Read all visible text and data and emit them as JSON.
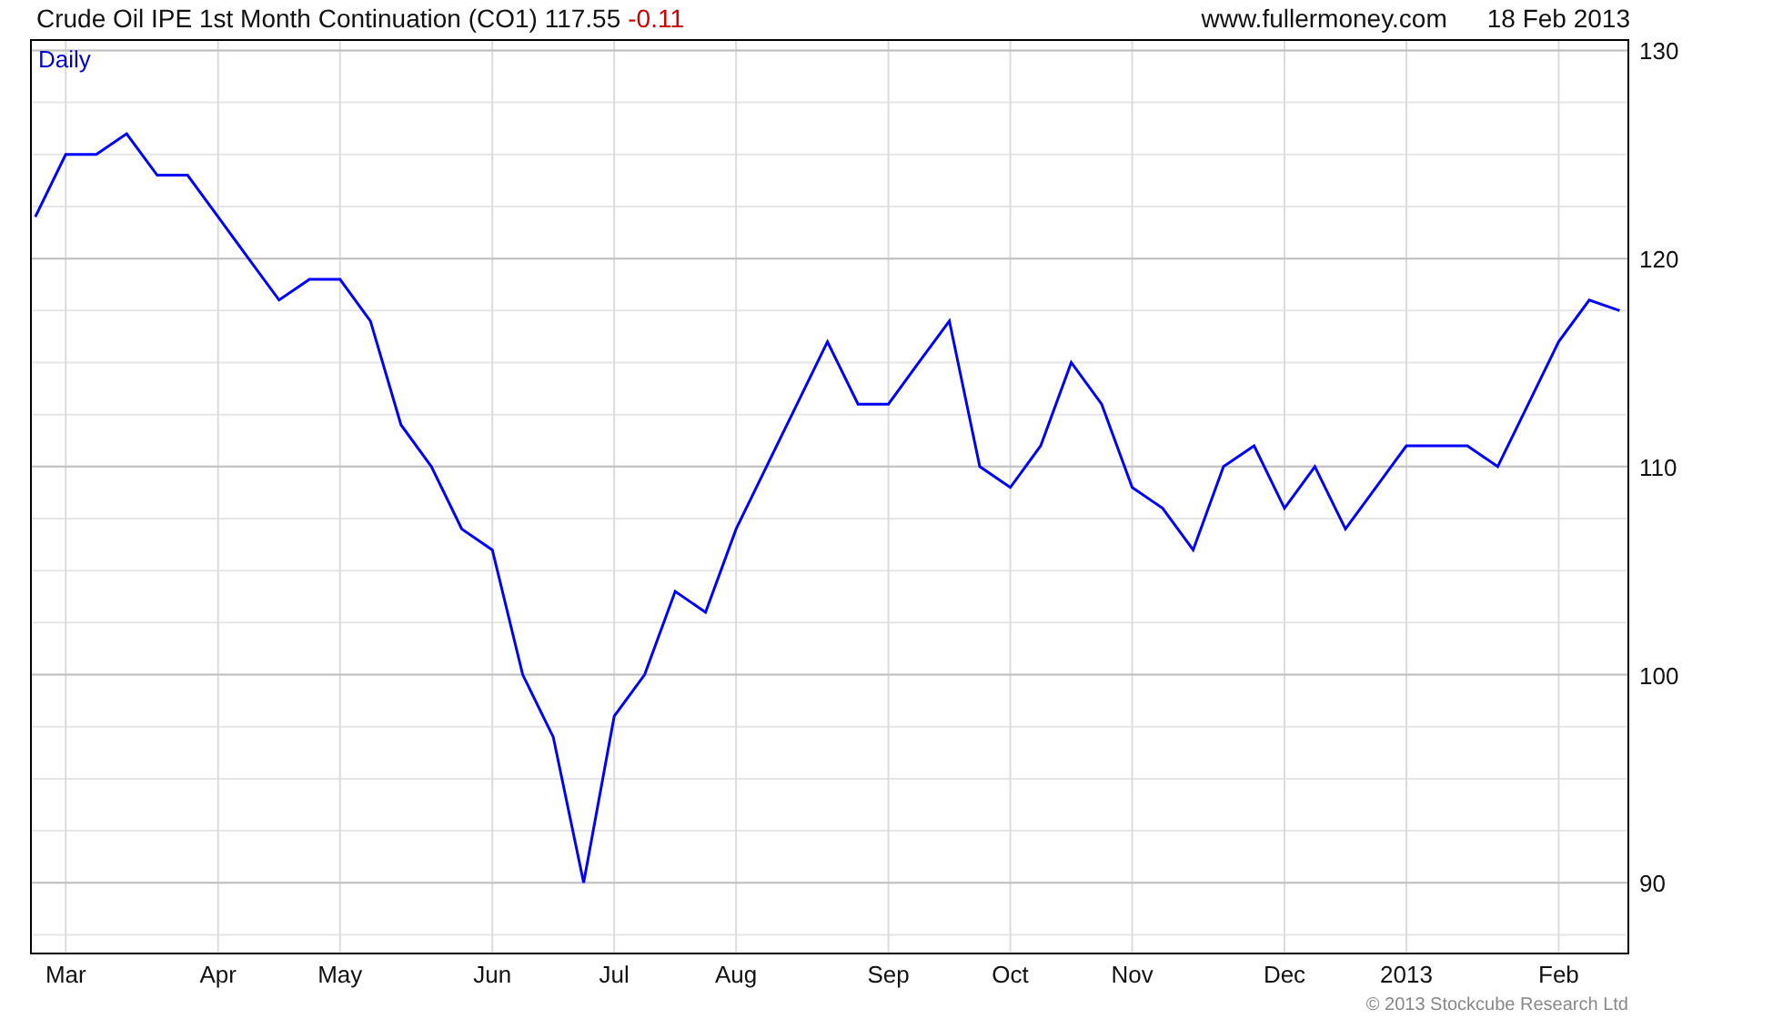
{
  "header": {
    "title": "Crude Oil IPE 1st Month Continuation (CO1) 117.55",
    "change": "-0.11",
    "source": "www.fullermoney.com",
    "date": "18 Feb 2013"
  },
  "chart": {
    "period_label": "Daily",
    "copyright": "© 2013 Stockcube Research Ltd",
    "chart_data": {
      "type": "line",
      "categories": [
        null,
        "Mar",
        null,
        null,
        null,
        null,
        "Apr",
        null,
        null,
        null,
        "May",
        null,
        null,
        null,
        null,
        "Jun",
        null,
        null,
        null,
        "Jul",
        null,
        null,
        null,
        "Aug",
        null,
        null,
        null,
        null,
        "Sep",
        null,
        null,
        null,
        "Oct",
        null,
        null,
        null,
        "Nov",
        null,
        null,
        null,
        null,
        "Dec",
        null,
        null,
        null,
        "2013",
        null,
        null,
        null,
        null,
        "Feb",
        null,
        null
      ],
      "series": [
        {
          "color": "#0000ff",
          "values": [
            122,
            125,
            125,
            126,
            124,
            124,
            122,
            120,
            118,
            119,
            119,
            117,
            112,
            110,
            107,
            106,
            100,
            97,
            90,
            98,
            100,
            104,
            103,
            107,
            110,
            113,
            116,
            113,
            113,
            115,
            117,
            110,
            109,
            111,
            115,
            113,
            109,
            108,
            106,
            110,
            111,
            108,
            110,
            107,
            109,
            111,
            111,
            111,
            110,
            113,
            116,
            118,
            117.5
          ]
        }
      ],
      "grid": true,
      "ylim": [
        86.6,
        130.5
      ],
      "yticks": [
        90,
        100,
        110,
        120,
        130
      ]
    }
  }
}
